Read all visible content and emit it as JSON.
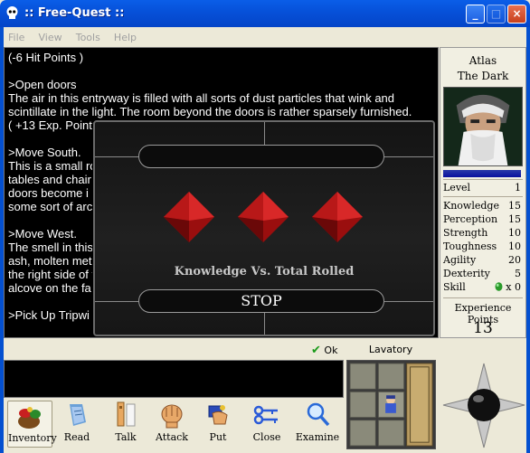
{
  "window": {
    "title": ":: Free-Quest ::"
  },
  "menu": [
    "File",
    "View",
    "Tools",
    "Help"
  ],
  "log": [
    "(-6 Hit Points )",
    ">Open doors\nThe air in this entryway is filled with all sorts of dust particles that wink and scintillate in the light. The room beyond the doors is rather sparsely furnished.\n( +13 Exp. Points",
    ">Move South.\nThis is a small ro\ntables and chair\ndoors become i\nsome sort of arc",
    ">Move West.\nThe smell in this\nash, molten meta\nthe right side of t\nalcove on the fa",
    ">Pick Up Tripwi"
  ],
  "dialog": {
    "label": "Knowledge Vs. Total Rolled",
    "stop": "STOP",
    "dice_count": 3,
    "dice_color": "#c01818"
  },
  "character": {
    "name": "Atlas",
    "epithet": "The Dark",
    "level_label": "Level",
    "level": "1",
    "stats": [
      {
        "label": "Knowledge",
        "value": "15"
      },
      {
        "label": "Perception",
        "value": "15"
      },
      {
        "label": "Strength",
        "value": "10"
      },
      {
        "label": "Toughness",
        "value": "10"
      },
      {
        "label": "Agility",
        "value": "20"
      },
      {
        "label": "Dexterity",
        "value": "5"
      },
      {
        "label": "Skill",
        "value": "x 0"
      }
    ],
    "exp_label": "Experience Points",
    "exp_value": "13"
  },
  "status": {
    "ok_label": "Ok"
  },
  "location": {
    "room": "Lavatory"
  },
  "toolbar": [
    {
      "label": "Inventory",
      "icon": "bag-icon"
    },
    {
      "label": "Read",
      "icon": "scroll-icon"
    },
    {
      "label": "Talk",
      "icon": "speech-icon"
    },
    {
      "label": "Attack",
      "icon": "fist-icon"
    },
    {
      "label": "Put",
      "icon": "hand-drop-icon"
    },
    {
      "label": "Close",
      "icon": "keys-icon"
    },
    {
      "label": "Examine",
      "icon": "magnifier-icon"
    }
  ],
  "colors": {
    "accent": "#0450d0",
    "log_bg": "#000000",
    "xp_bar": "#1a2aa8"
  }
}
